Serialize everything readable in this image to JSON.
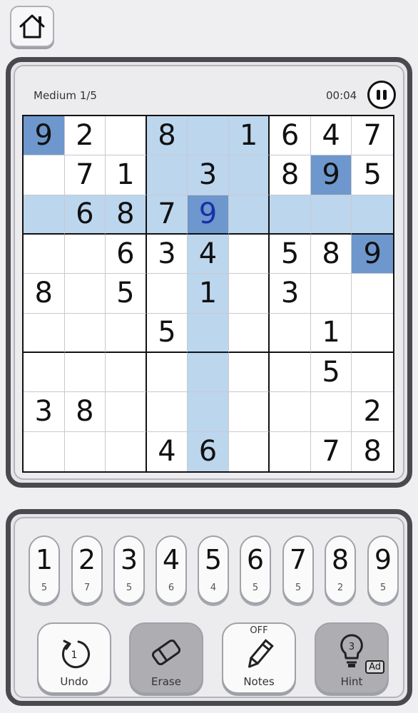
{
  "header": {
    "home_icon": "house-icon"
  },
  "board": {
    "difficulty": "Medium 1/5",
    "timer": "00:04",
    "pause_icon": "pause-icon",
    "cells": [
      [
        "9",
        "2",
        "",
        "8",
        "",
        "1",
        "6",
        "4",
        "7"
      ],
      [
        "",
        "7",
        "1",
        "",
        "3",
        "",
        "8",
        "9",
        "5"
      ],
      [
        "",
        "6",
        "8",
        "7",
        "9",
        "",
        "",
        "",
        ""
      ],
      [
        "",
        "",
        "6",
        "3",
        "4",
        "",
        "5",
        "8",
        "9"
      ],
      [
        "8",
        "",
        "5",
        "",
        "1",
        "",
        "3",
        "",
        ""
      ],
      [
        "",
        "",
        "",
        "5",
        "",
        "",
        "",
        "1",
        ""
      ],
      [
        "",
        "",
        "",
        "",
        "",
        "",
        "",
        "5",
        ""
      ],
      [
        "3",
        "8",
        "",
        "",
        "",
        "",
        "",
        "",
        "2"
      ],
      [
        "",
        "",
        "",
        "4",
        "6",
        "",
        "",
        "7",
        "8"
      ]
    ],
    "selected": {
      "row": 2,
      "col": 4
    },
    "colors": {
      "highlight": "#bcd6ee",
      "same_number": "#6d97cd",
      "selected_text": "#1a2fa8"
    }
  },
  "numpad": [
    {
      "digit": "1",
      "remaining": "5"
    },
    {
      "digit": "2",
      "remaining": "7"
    },
    {
      "digit": "3",
      "remaining": "5"
    },
    {
      "digit": "4",
      "remaining": "6"
    },
    {
      "digit": "5",
      "remaining": "4"
    },
    {
      "digit": "6",
      "remaining": "5"
    },
    {
      "digit": "7",
      "remaining": "5"
    },
    {
      "digit": "8",
      "remaining": "2"
    },
    {
      "digit": "9",
      "remaining": "5"
    }
  ],
  "actions": {
    "undo": {
      "label": "Undo",
      "icon": "undo-icon",
      "badge": "1"
    },
    "erase": {
      "label": "Erase",
      "icon": "eraser-icon"
    },
    "notes": {
      "label": "Notes",
      "icon": "pencil-icon",
      "state": "OFF"
    },
    "hint": {
      "label": "Hint",
      "icon": "lightbulb-icon",
      "count": "3",
      "ad": "Ad"
    }
  }
}
